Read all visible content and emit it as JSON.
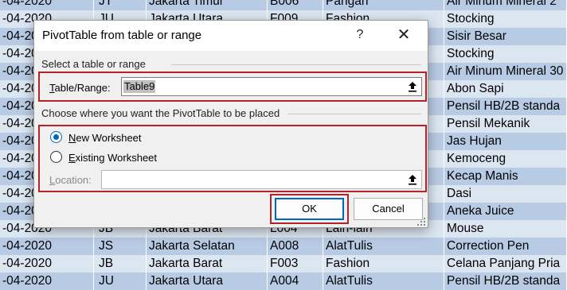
{
  "sheet": {
    "rows": [
      {
        "date": "-04-2020",
        "code": "JT",
        "city": "Jakarta Timur",
        "id": "B006",
        "category": "Pangan",
        "product": "Air Minum Mineral 2"
      },
      {
        "date": "-04-2020",
        "code": "JU",
        "city": "Jakarta Utara",
        "id": "F009",
        "category": "Fashion",
        "product": "Stocking"
      },
      {
        "date": "-04-2020",
        "code": "",
        "city": "",
        "id": "",
        "category": "",
        "product": "Sisir Besar"
      },
      {
        "date": "-04-2020",
        "code": "",
        "city": "",
        "id": "",
        "category": "",
        "product": "Stocking"
      },
      {
        "date": "-04-2020",
        "code": "",
        "city": "",
        "id": "",
        "category": "",
        "product": "Air Minum Mineral 30"
      },
      {
        "date": "-04-2020",
        "code": "",
        "city": "",
        "id": "",
        "category": "",
        "product": "Abon Sapi"
      },
      {
        "date": "-04-2020",
        "code": "",
        "city": "",
        "id": "",
        "category": "",
        "product": "Pensil HB/2B standa"
      },
      {
        "date": "-04-2020",
        "code": "",
        "city": "",
        "id": "",
        "category": "",
        "product": "Pensil Mekanik"
      },
      {
        "date": "-04-2020",
        "code": "",
        "city": "",
        "id": "",
        "category": "",
        "product": "Jas Hujan"
      },
      {
        "date": "-04-2020",
        "code": "",
        "city": "",
        "id": "",
        "category": "",
        "product": "Kemoceng"
      },
      {
        "date": "-04-2020",
        "code": "",
        "city": "",
        "id": "",
        "category": "",
        "product": "Kecap Manis"
      },
      {
        "date": "-04-2020",
        "code": "",
        "city": "",
        "id": "",
        "category": "",
        "product": "Dasi"
      },
      {
        "date": "-04-2020",
        "code": "",
        "city": "",
        "id": "",
        "category": "",
        "product": "Aneka Juice"
      },
      {
        "date": "-04-2020",
        "code": "JB",
        "city": "Jakarta Barat",
        "id": "L004",
        "category": "Lain-lain",
        "product": "Mouse"
      },
      {
        "date": "-04-2020",
        "code": "JS",
        "city": "Jakarta Selatan",
        "id": "A008",
        "category": "AlatTulis",
        "product": "Correction Pen"
      },
      {
        "date": "-04-2020",
        "code": "JB",
        "city": "Jakarta Barat",
        "id": "F003",
        "category": "Fashion",
        "product": "Celana Panjang Pria"
      },
      {
        "date": "-04-2020",
        "code": "JU",
        "city": "Jakarta Utara",
        "id": "A004",
        "category": "AlatTulis",
        "product": "Pensil HB/2B standa"
      }
    ]
  },
  "dialog": {
    "title": "PivotTable from table or range",
    "help_label": "?",
    "close_label": "✕",
    "section1_label": "Select a table or range",
    "table_range_label": "Table/Range:",
    "table_range_value": "Table9",
    "section2_label": "Choose where you want the PivotTable to be placed",
    "option_new": "New Worksheet",
    "option_existing": "Existing Worksheet",
    "selected_option": "New Worksheet",
    "location_label": "Location:",
    "location_value": "",
    "ok_label": "OK",
    "cancel_label": "Cancel"
  },
  "colors": {
    "accent": "#0067c0",
    "highlight_box": "#b3222a",
    "band_row": "#b8cbe4",
    "plain_row": "#dce6f1"
  }
}
